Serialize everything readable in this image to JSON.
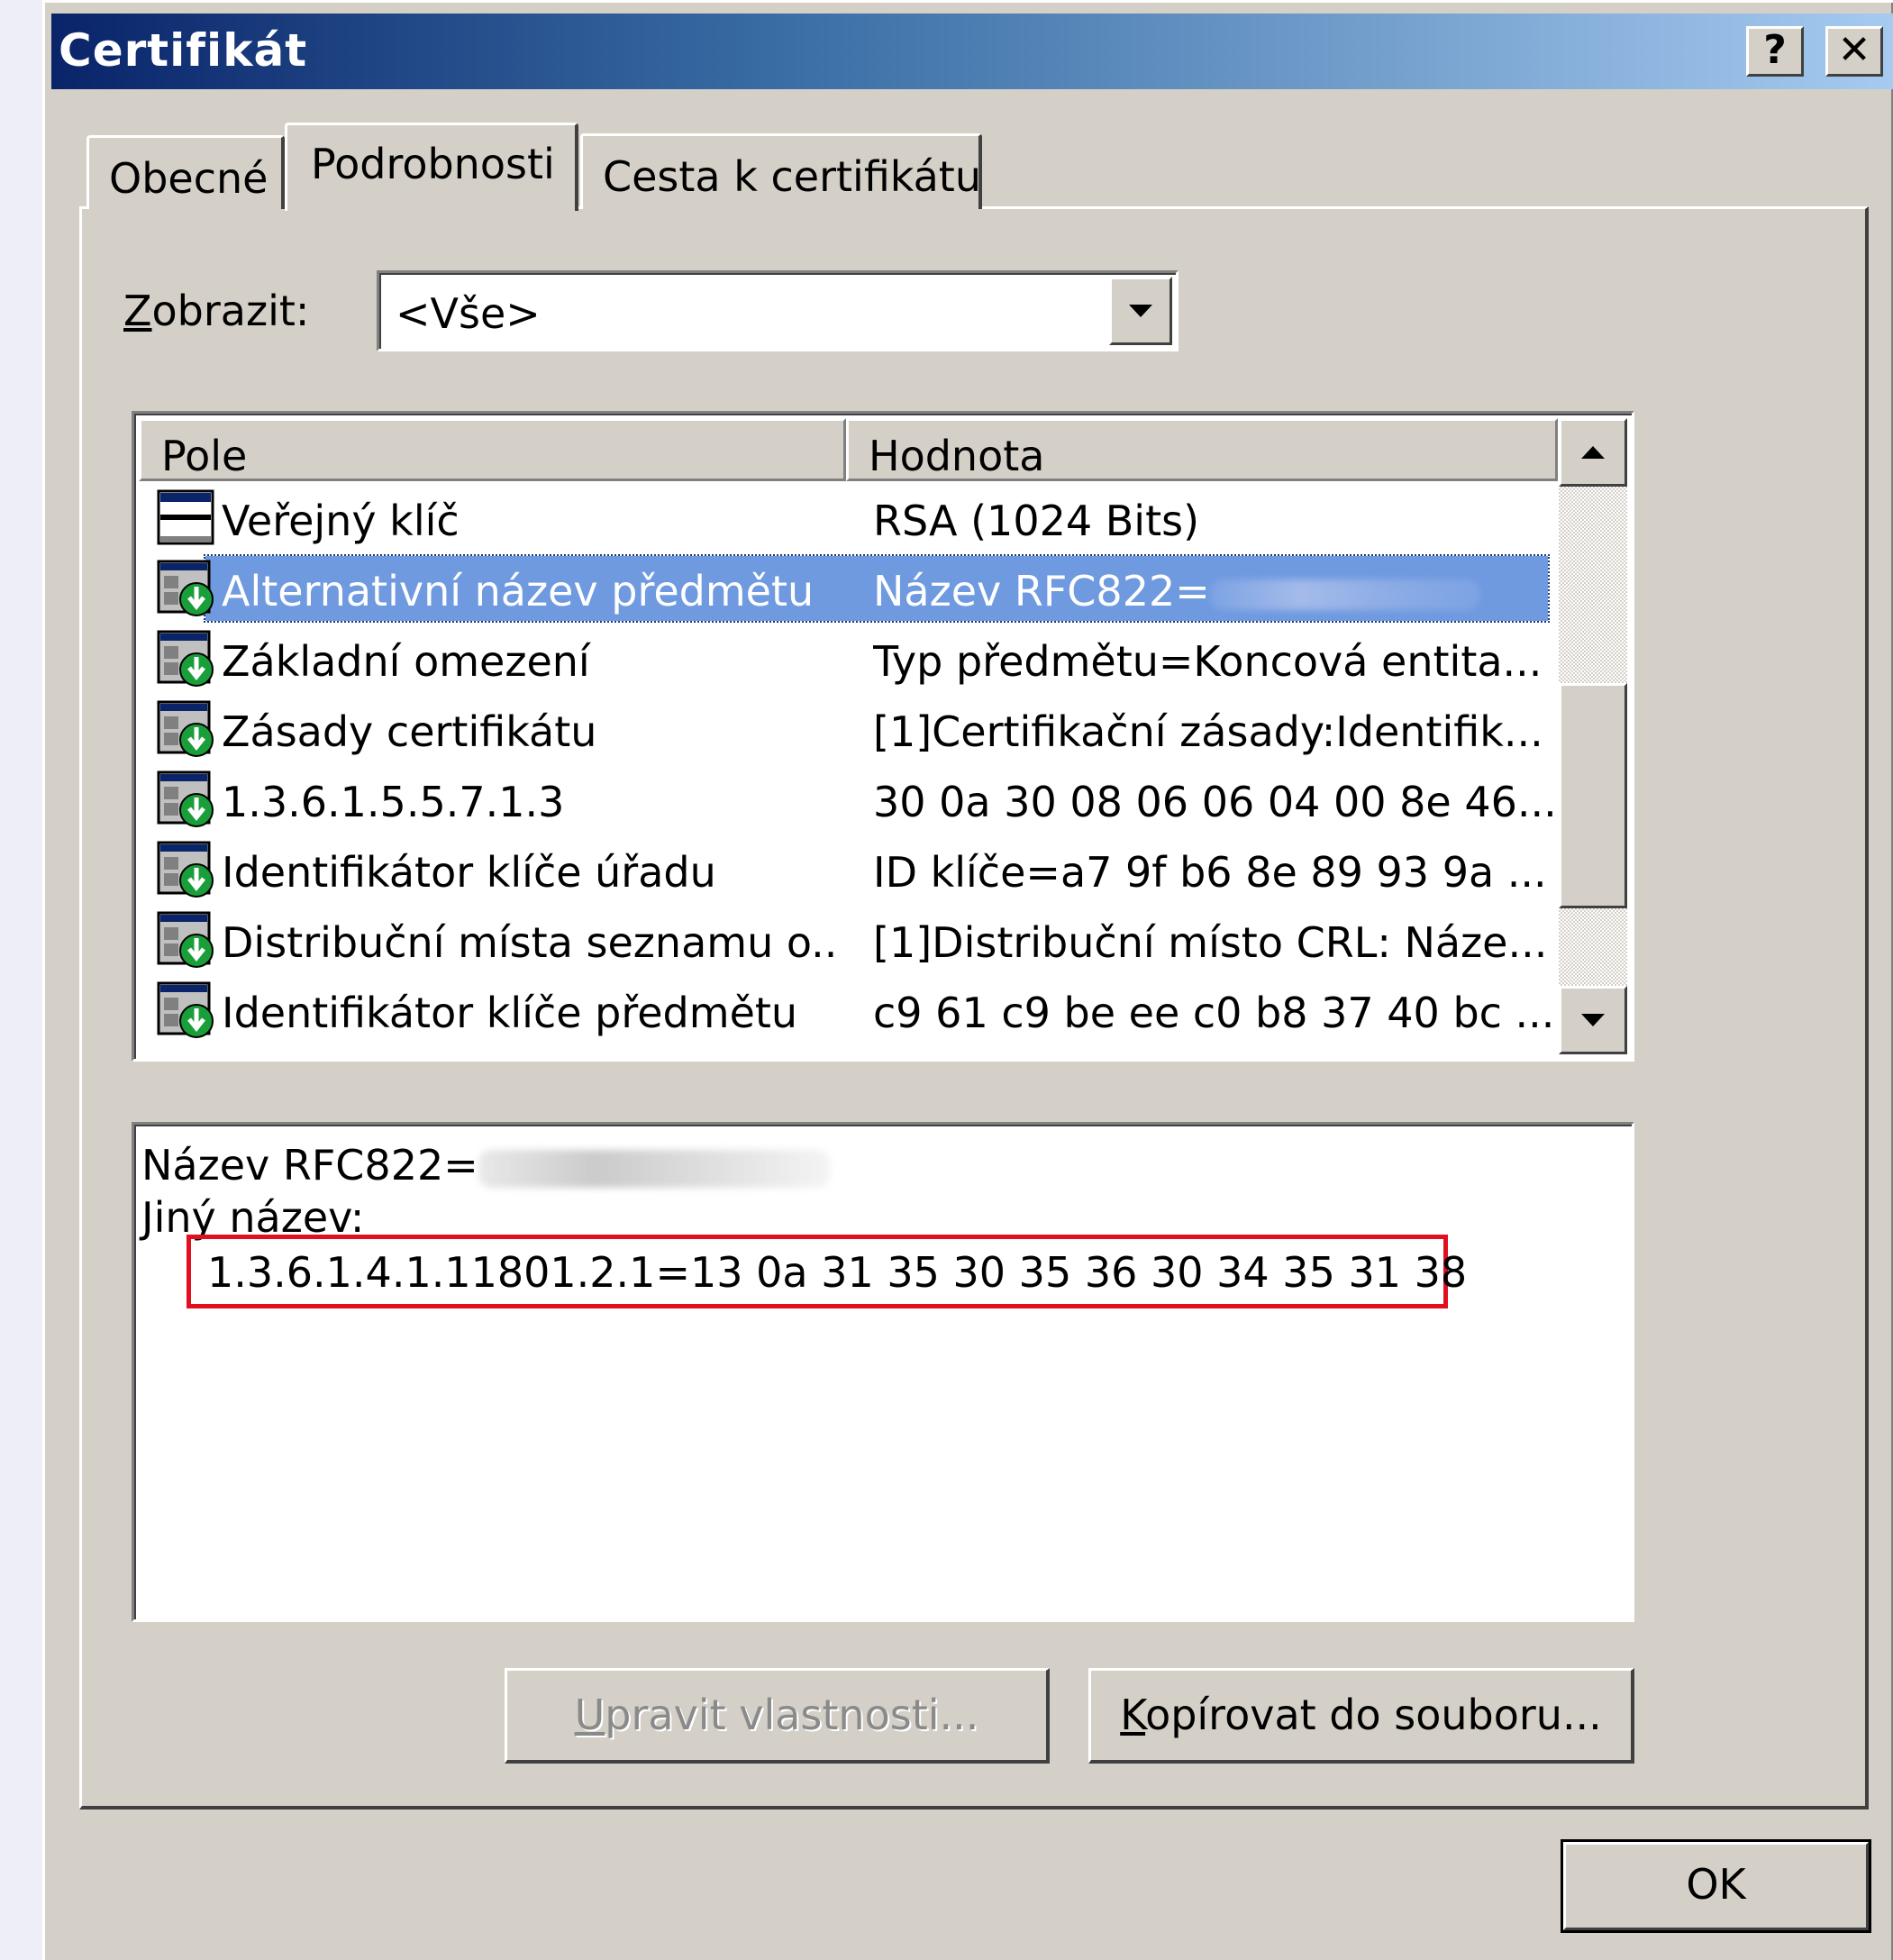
{
  "window": {
    "title": "Certifikát",
    "help_label": "?",
    "close_label": "✕"
  },
  "tabs": [
    {
      "label": "Obecné",
      "active": false
    },
    {
      "label": "Podrobnosti",
      "active": true
    },
    {
      "label": "Cesta k certifikátu",
      "active": false
    }
  ],
  "show": {
    "label_accel": "Z",
    "label_rest": "obrazit:",
    "value": "<Vše>"
  },
  "list": {
    "headers": [
      "Pole",
      "Hodnota"
    ],
    "rows": [
      {
        "field": "Veřejný klíč",
        "value": "RSA (1024 Bits)",
        "icon": "public-key-icon",
        "selected": false
      },
      {
        "field": "Alternativní název předmětu",
        "value": "Název RFC822=",
        "icon": "extension-icon",
        "selected": true
      },
      {
        "field": "Základní omezení",
        "value": "Typ předmětu=Koncová entita...",
        "icon": "extension-icon",
        "selected": false
      },
      {
        "field": "Zásady certifikátu",
        "value": "[1]Certifikační zásady:Identifik...",
        "icon": "extension-icon",
        "selected": false
      },
      {
        "field": "1.3.6.1.5.5.7.1.3",
        "value": "30 0a 30 08 06 06 04 00 8e 46...",
        "icon": "extension-icon",
        "selected": false
      },
      {
        "field": "Identifikátor klíče úřadu",
        "value": "ID klíče=a7 9f b6 8e 89 93 9a ...",
        "icon": "extension-icon",
        "selected": false
      },
      {
        "field": "Distribuční místa seznamu o...",
        "value": "[1]Distribuční místo CRL: Náze...",
        "icon": "extension-icon",
        "selected": false
      },
      {
        "field": "Identifikátor klíče předmětu",
        "value": "c9 61 c9 be ee c0 b8 37 40 bc ...",
        "icon": "extension-icon",
        "selected": false
      }
    ]
  },
  "detail": {
    "line1": "Název RFC822=",
    "line2": "Jiný název:",
    "highlighted": "1.3.6.1.4.1.11801.2.1=13 0a 31 35 30 35 36 30 34 35 31 38"
  },
  "buttons": {
    "edit_accel": "U",
    "edit_rest": "pravit vlastnosti...",
    "copy_accel": "K",
    "copy_rest": "opírovat do souboru...",
    "ok": "OK"
  },
  "colors": {
    "title_gradient_start": "#0a246a",
    "title_gradient_end": "#a6caf0",
    "selection": "#6f9ae0",
    "highlight_box": "#e01020",
    "face": "#d4d0c8"
  }
}
